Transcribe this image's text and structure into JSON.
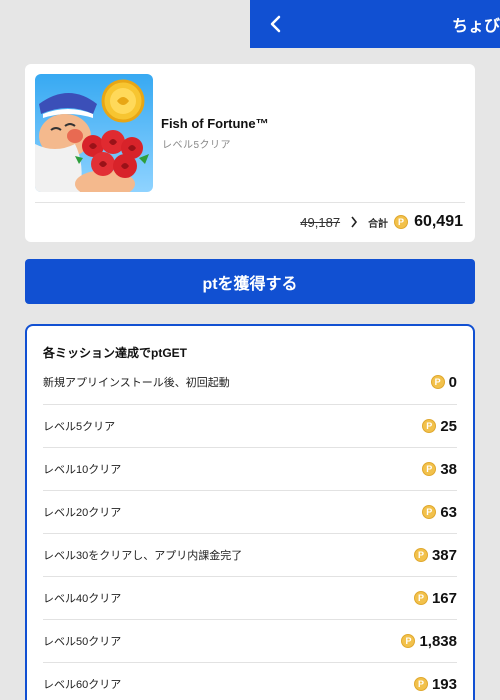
{
  "header": {
    "title": "ちょび",
    "back_icon": "chevron-left-icon",
    "color": "#1150d2"
  },
  "app": {
    "name": "Fish of Fortune™",
    "subtitle": "レベル5クリア",
    "old_price": "49,187",
    "total_label": "合計",
    "total_value": "60,491"
  },
  "coin_symbol": "P",
  "cta": {
    "label": "ptを獲得する"
  },
  "missions": {
    "title": "各ミッション達成でptGET",
    "items": [
      {
        "label": "新規アプリインストール後、初回起動",
        "reward": "0"
      },
      {
        "label": "レベル5クリア",
        "reward": "25"
      },
      {
        "label": "レベル10クリア",
        "reward": "38"
      },
      {
        "label": "レベル20クリア",
        "reward": "63"
      },
      {
        "label": "レベル30をクリアし、アプリ内課金完了",
        "reward": "387"
      },
      {
        "label": "レベル40クリア",
        "reward": "167"
      },
      {
        "label": "レベル50クリア",
        "reward": "1,838"
      },
      {
        "label": "レベル60クリア",
        "reward": "193"
      }
    ]
  }
}
